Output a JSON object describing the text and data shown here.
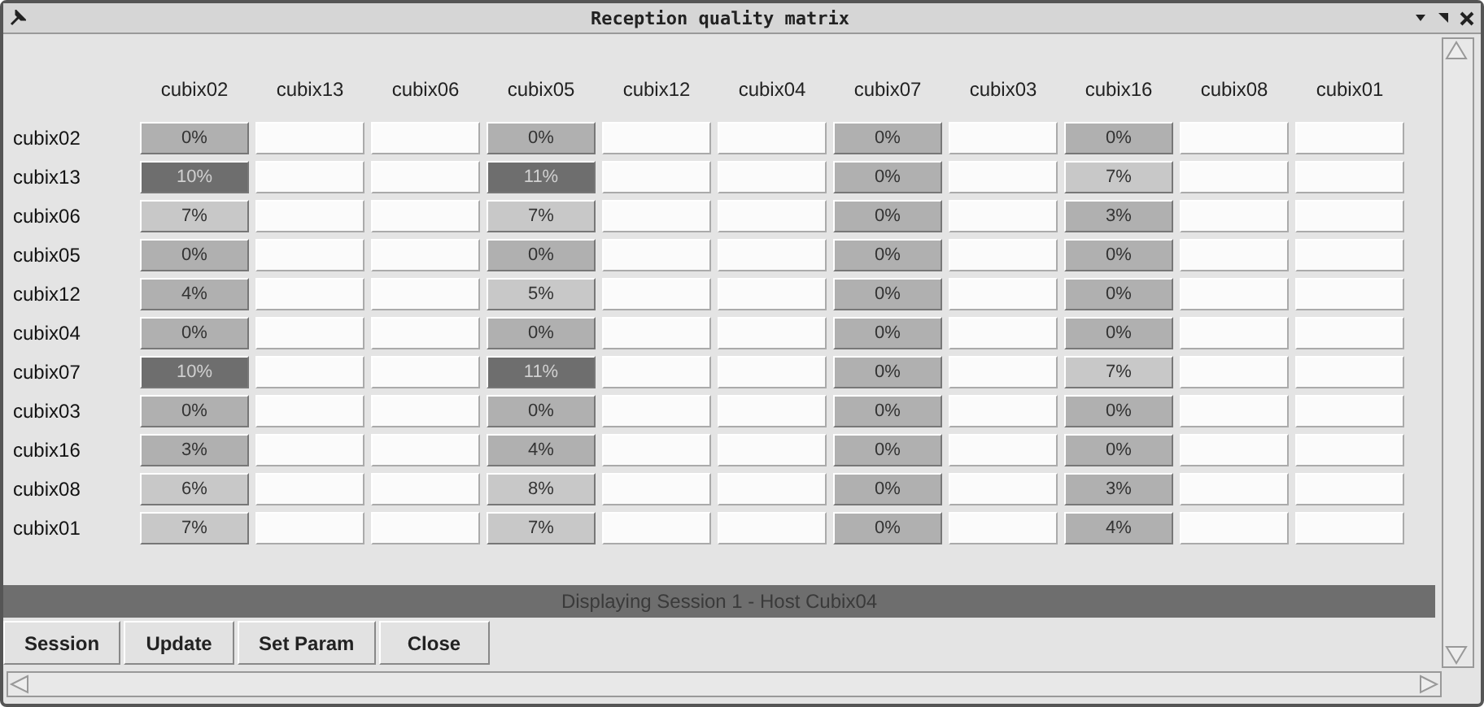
{
  "window": {
    "title": "Reception quality matrix"
  },
  "matrix": {
    "columns": [
      "cubix02",
      "cubix13",
      "cubix06",
      "cubix05",
      "cubix12",
      "cubix04",
      "cubix07",
      "cubix03",
      "cubix16",
      "cubix08",
      "cubix01"
    ],
    "rows": [
      {
        "label": "cubix02",
        "cells": [
          {
            "kind": "medium",
            "value": "0%"
          },
          {
            "kind": "empty"
          },
          {
            "kind": "empty"
          },
          {
            "kind": "medium",
            "value": "0%"
          },
          {
            "kind": "empty"
          },
          {
            "kind": "empty"
          },
          {
            "kind": "medium",
            "value": "0%"
          },
          {
            "kind": "empty"
          },
          {
            "kind": "medium",
            "value": "0%"
          },
          {
            "kind": "empty"
          },
          {
            "kind": "empty"
          }
        ]
      },
      {
        "label": "cubix13",
        "cells": [
          {
            "kind": "dark",
            "value": "10%"
          },
          {
            "kind": "empty"
          },
          {
            "kind": "empty"
          },
          {
            "kind": "dark",
            "value": "11%"
          },
          {
            "kind": "empty"
          },
          {
            "kind": "empty"
          },
          {
            "kind": "medium",
            "value": "0%"
          },
          {
            "kind": "empty"
          },
          {
            "kind": "light",
            "value": "7%"
          },
          {
            "kind": "empty"
          },
          {
            "kind": "empty"
          }
        ]
      },
      {
        "label": "cubix06",
        "cells": [
          {
            "kind": "light",
            "value": "7%"
          },
          {
            "kind": "empty"
          },
          {
            "kind": "empty"
          },
          {
            "kind": "light",
            "value": "7%"
          },
          {
            "kind": "empty"
          },
          {
            "kind": "empty"
          },
          {
            "kind": "medium",
            "value": "0%"
          },
          {
            "kind": "empty"
          },
          {
            "kind": "medium",
            "value": "3%"
          },
          {
            "kind": "empty"
          },
          {
            "kind": "empty"
          }
        ]
      },
      {
        "label": "cubix05",
        "cells": [
          {
            "kind": "medium",
            "value": "0%"
          },
          {
            "kind": "empty"
          },
          {
            "kind": "empty"
          },
          {
            "kind": "medium",
            "value": "0%"
          },
          {
            "kind": "empty"
          },
          {
            "kind": "empty"
          },
          {
            "kind": "medium",
            "value": "0%"
          },
          {
            "kind": "empty"
          },
          {
            "kind": "medium",
            "value": "0%"
          },
          {
            "kind": "empty"
          },
          {
            "kind": "empty"
          }
        ]
      },
      {
        "label": "cubix12",
        "cells": [
          {
            "kind": "medium",
            "value": "4%"
          },
          {
            "kind": "empty"
          },
          {
            "kind": "empty"
          },
          {
            "kind": "light",
            "value": "5%"
          },
          {
            "kind": "empty"
          },
          {
            "kind": "empty"
          },
          {
            "kind": "medium",
            "value": "0%"
          },
          {
            "kind": "empty"
          },
          {
            "kind": "medium",
            "value": "0%"
          },
          {
            "kind": "empty"
          },
          {
            "kind": "empty"
          }
        ]
      },
      {
        "label": "cubix04",
        "cells": [
          {
            "kind": "medium",
            "value": "0%"
          },
          {
            "kind": "empty"
          },
          {
            "kind": "empty"
          },
          {
            "kind": "medium",
            "value": "0%"
          },
          {
            "kind": "empty"
          },
          {
            "kind": "empty"
          },
          {
            "kind": "medium",
            "value": "0%"
          },
          {
            "kind": "empty"
          },
          {
            "kind": "medium",
            "value": "0%"
          },
          {
            "kind": "empty"
          },
          {
            "kind": "empty"
          }
        ]
      },
      {
        "label": "cubix07",
        "cells": [
          {
            "kind": "dark",
            "value": "10%"
          },
          {
            "kind": "empty"
          },
          {
            "kind": "empty"
          },
          {
            "kind": "dark",
            "value": "11%"
          },
          {
            "kind": "empty"
          },
          {
            "kind": "empty"
          },
          {
            "kind": "medium",
            "value": "0%"
          },
          {
            "kind": "empty"
          },
          {
            "kind": "light",
            "value": "7%"
          },
          {
            "kind": "empty"
          },
          {
            "kind": "empty"
          }
        ]
      },
      {
        "label": "cubix03",
        "cells": [
          {
            "kind": "medium",
            "value": "0%"
          },
          {
            "kind": "empty"
          },
          {
            "kind": "empty"
          },
          {
            "kind": "medium",
            "value": "0%"
          },
          {
            "kind": "empty"
          },
          {
            "kind": "empty"
          },
          {
            "kind": "medium",
            "value": "0%"
          },
          {
            "kind": "empty"
          },
          {
            "kind": "medium",
            "value": "0%"
          },
          {
            "kind": "empty"
          },
          {
            "kind": "empty"
          }
        ]
      },
      {
        "label": "cubix16",
        "cells": [
          {
            "kind": "medium",
            "value": "3%"
          },
          {
            "kind": "empty"
          },
          {
            "kind": "empty"
          },
          {
            "kind": "medium",
            "value": "4%"
          },
          {
            "kind": "empty"
          },
          {
            "kind": "empty"
          },
          {
            "kind": "medium",
            "value": "0%"
          },
          {
            "kind": "empty"
          },
          {
            "kind": "medium",
            "value": "0%"
          },
          {
            "kind": "empty"
          },
          {
            "kind": "empty"
          }
        ]
      },
      {
        "label": "cubix08",
        "cells": [
          {
            "kind": "light",
            "value": "6%"
          },
          {
            "kind": "empty"
          },
          {
            "kind": "empty"
          },
          {
            "kind": "light",
            "value": "8%"
          },
          {
            "kind": "empty"
          },
          {
            "kind": "empty"
          },
          {
            "kind": "medium",
            "value": "0%"
          },
          {
            "kind": "empty"
          },
          {
            "kind": "medium",
            "value": "3%"
          },
          {
            "kind": "empty"
          },
          {
            "kind": "empty"
          }
        ]
      },
      {
        "label": "cubix01",
        "cells": [
          {
            "kind": "light",
            "value": "7%"
          },
          {
            "kind": "empty"
          },
          {
            "kind": "empty"
          },
          {
            "kind": "light",
            "value": "7%"
          },
          {
            "kind": "empty"
          },
          {
            "kind": "empty"
          },
          {
            "kind": "medium",
            "value": "0%"
          },
          {
            "kind": "empty"
          },
          {
            "kind": "medium",
            "value": "4%"
          },
          {
            "kind": "empty"
          },
          {
            "kind": "empty"
          }
        ]
      }
    ]
  },
  "status_bar": "Displaying Session 1 - Host Cubix04",
  "buttons": [
    "Session",
    "Update",
    "Set Param",
    "Close"
  ]
}
